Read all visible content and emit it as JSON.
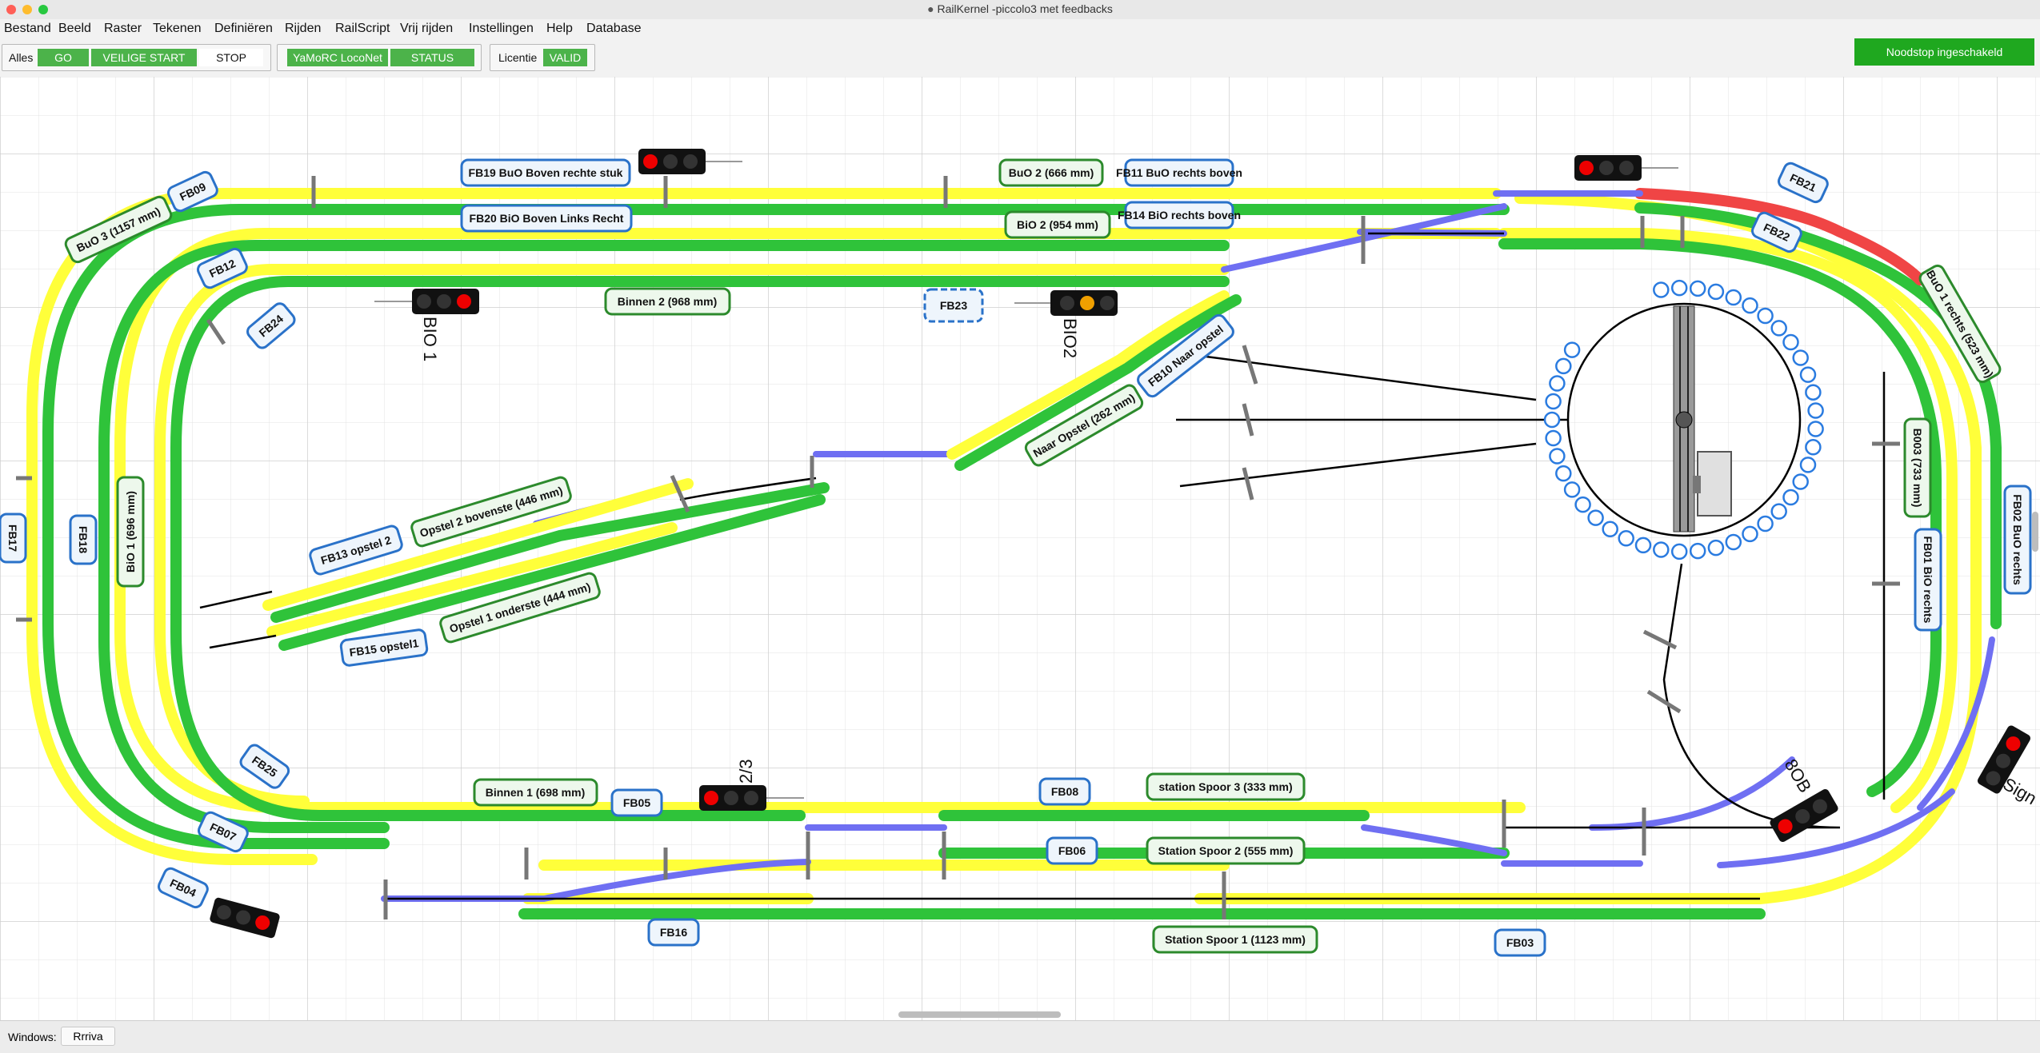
{
  "window": {
    "title": "RailKernel -piccolo3 met feedbacks"
  },
  "menu": [
    "Bestand",
    "Beeld",
    "Raster",
    "Tekenen",
    "Definiëren",
    "Rijden",
    "RailScript",
    "Vrij rijden",
    "Instellingen",
    "Help",
    "Database"
  ],
  "toolbar": {
    "alles_label": "Alles",
    "go": "GO",
    "safe_start": "VEILIGE START",
    "stop": "STOP",
    "loconet": "YaMoRC LocoNet",
    "status": "STATUS",
    "licentie_label": "Licentie",
    "valid": "VALID",
    "emergency": "Noodstop ingeschakeld"
  },
  "colors": {
    "occupied": "#2fc33a",
    "reserved": "#ffff3a",
    "route": "#6f6ff2",
    "alarm": "#f04545",
    "feedback_border": "#2a72c9",
    "block_border": "#2c8a2c"
  },
  "feedbacks": [
    "FB19 BuO Boven rechte stuk",
    "FB20 BiO Boven Links Recht",
    "FB11 BuO rechts boven",
    "FB14 BiO rechts boven",
    "FB09",
    "FB12",
    "FB24",
    "FB23",
    "FB21",
    "FB22",
    "FB17",
    "FB18",
    "FB13 opstel 2",
    "FB15 opstel1",
    "FB10 Naar opstel",
    "FB25",
    "FB07",
    "FB04",
    "FB05",
    "FB08",
    "FB06",
    "FB16",
    "FB03",
    "FB01 BiO rechts",
    "FB02 BuO rechts"
  ],
  "blocks": [
    "BuO 3 (1157 mm)",
    "BuO 2 (666 mm)",
    "BiO 2 (954 mm)",
    "Binnen 2 (968 mm)",
    "BiO 1 (696 mm)",
    "Opstel 2 bovenste (446 mm)",
    "Opstel 1 onderste (444 mm)",
    "Naar Opstel (262 mm)",
    "BuO 1 rechts (523 mm)",
    "B003 (733 mm)",
    "Binnen 1 (698 mm)",
    "station Spoor 3 (333 mm)",
    "Station Spoor 2 (555 mm)",
    "Station Spoor 1 (1123 mm)"
  ],
  "signals": [
    "BIO 1",
    "BIO2",
    "2/3",
    "8OB",
    "Sign"
  ],
  "statusbar": {
    "windows_label": "Windows:",
    "window_button": "Rrriva"
  }
}
